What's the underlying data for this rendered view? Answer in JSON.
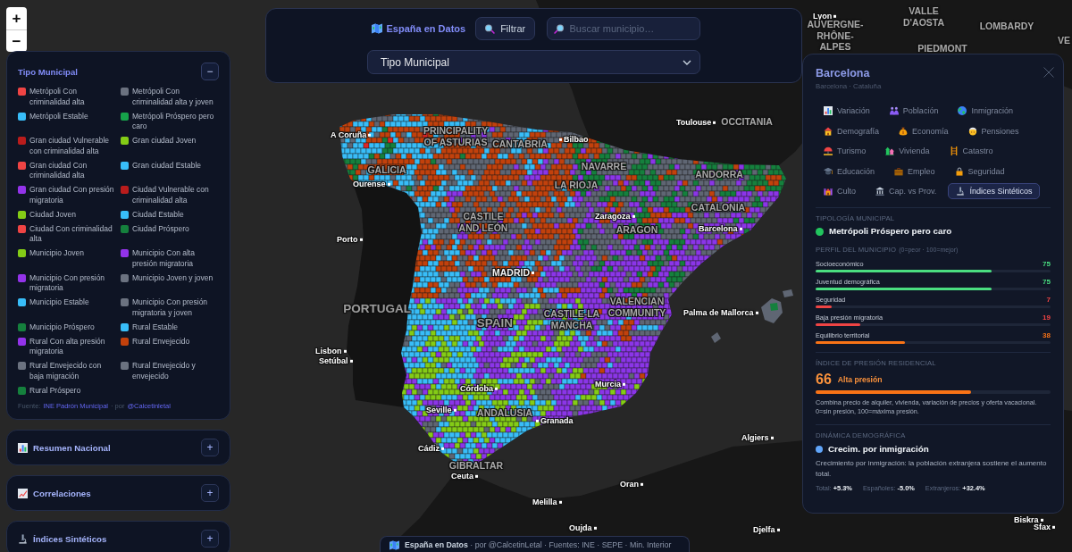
{
  "map_controls": {
    "zoom_in": "+",
    "zoom_out": "−"
  },
  "side_panels": [
    {
      "title": "Tipo Municipal",
      "toggle": "−",
      "expanded": true,
      "legend": [
        {
          "label": "Metrópoli Con criminalidad alta",
          "color": "#ef4444"
        },
        {
          "label": "Metrópoli Con criminalidad alta y joven",
          "color": "#6b7280"
        },
        {
          "label": "Metrópoli Estable",
          "color": "#38bdf8"
        },
        {
          "label": "Metrópoli Próspero pero caro",
          "color": "#16a34a"
        },
        {
          "label": "Gran ciudad Vulnerable con criminalidad alta",
          "color": "#b91c1c"
        },
        {
          "label": "Gran ciudad Joven",
          "color": "#84cc16"
        },
        {
          "label": "Gran ciudad Con criminalidad alta",
          "color": "#ef4444"
        },
        {
          "label": "Gran ciudad Estable",
          "color": "#38bdf8"
        },
        {
          "label": "Gran ciudad Con presión migratoria",
          "color": "#9333ea"
        },
        {
          "label": "Ciudad Vulnerable con criminalidad alta",
          "color": "#b91c1c"
        },
        {
          "label": "Ciudad Joven",
          "color": "#84cc16"
        },
        {
          "label": "Ciudad Estable",
          "color": "#38bdf8"
        },
        {
          "label": "Ciudad Con criminalidad alta",
          "color": "#ef4444"
        },
        {
          "label": "Ciudad Próspero",
          "color": "#15803d"
        },
        {
          "label": "Municipio Joven",
          "color": "#84cc16"
        },
        {
          "label": "Municipio Con alta presión migratoria",
          "color": "#9333ea"
        },
        {
          "label": "Municipio Con presión migratoria",
          "color": "#9333ea"
        },
        {
          "label": "Municipio Joven y joven",
          "color": "#6b7280"
        },
        {
          "label": "Municipio Estable",
          "color": "#38bdf8"
        },
        {
          "label": "Municipio Con presión migratoria y joven",
          "color": "#6b7280"
        },
        {
          "label": "Municipio Próspero",
          "color": "#15803d"
        },
        {
          "label": "Rural Estable",
          "color": "#38bdf8"
        },
        {
          "label": "Rural Con alta presión migratoria",
          "color": "#9333ea"
        },
        {
          "label": "Rural Envejecido",
          "color": "#c2410c"
        },
        {
          "label": "Rural Envejecido con baja migración",
          "color": "#6b7280"
        },
        {
          "label": "Rural Envejecido y envejecido",
          "color": "#6b7280"
        },
        {
          "label": "Rural Próspero",
          "color": "#15803d"
        }
      ],
      "source_note": [
        {
          "kind": "text",
          "text": "Fuente:"
        },
        {
          "kind": "link",
          "text": "INE Padrón Municipal"
        },
        {
          "kind": "text",
          "text": "· por"
        },
        {
          "kind": "link",
          "text": "@Calcetinletal"
        }
      ]
    },
    {
      "title": "Resumen Nacional",
      "toggle": "+",
      "expanded": false
    },
    {
      "title": "Correlaciones",
      "toggle": "+",
      "expanded": false
    },
    {
      "title": "Índices Sintéticos",
      "toggle": "+",
      "expanded": false
    }
  ],
  "header": {
    "title": "España en Datos",
    "filter_button": "Filtrar",
    "search": {
      "placeholder": "Buscar municipio…"
    },
    "layer_select": {
      "value": "Tipo Municipal"
    }
  },
  "map_labels": [
    {
      "text": "Lyon",
      "kind": "city"
    },
    {
      "text": "VALLE D'AOSTA",
      "kind": "region"
    },
    {
      "text": "AUVERGNE-RHÔNE-ALPES",
      "kind": "region"
    },
    {
      "text": "LOMBARDY",
      "kind": "region"
    },
    {
      "text": "PIEDMONT",
      "kind": "region"
    },
    {
      "text": "VE",
      "kind": "region"
    },
    {
      "text": "Toulouse",
      "kind": "city"
    },
    {
      "text": "OCCITANIA",
      "kind": "region"
    },
    {
      "text": "A Coruña",
      "kind": "city"
    },
    {
      "text": "PRINCIPALITY OF ASTURIAS",
      "kind": "region"
    },
    {
      "text": "CANTABRIA",
      "kind": "region"
    },
    {
      "text": "Bilbao",
      "kind": "city"
    },
    {
      "text": "GALICIA",
      "kind": "region"
    },
    {
      "text": "NAVARRE",
      "kind": "region"
    },
    {
      "text": "ANDORRA",
      "kind": "region"
    },
    {
      "text": "Ourense",
      "kind": "city"
    },
    {
      "text": "LA RIOJA",
      "kind": "region"
    },
    {
      "text": "CATALONIA",
      "kind": "region"
    },
    {
      "text": "CASTILE AND LEÓN",
      "kind": "region"
    },
    {
      "text": "Zaragoza",
      "kind": "city"
    },
    {
      "text": "ARAGON",
      "kind": "region"
    },
    {
      "text": "Barcelona",
      "kind": "city"
    },
    {
      "text": "Porto",
      "kind": "city"
    },
    {
      "text": "MADRID",
      "kind": "capital"
    },
    {
      "text": "PORTUGAL",
      "kind": "country"
    },
    {
      "text": "SPAIN",
      "kind": "country"
    },
    {
      "text": "CASTILE-LA MANCHA",
      "kind": "region"
    },
    {
      "text": "VALENCIAN COMMUNITY",
      "kind": "region"
    },
    {
      "text": "Palma de Mallorca",
      "kind": "city"
    },
    {
      "text": "Lisbon",
      "kind": "city"
    },
    {
      "text": "Setúbal",
      "kind": "city"
    },
    {
      "text": "Córdoba",
      "kind": "city"
    },
    {
      "text": "Murcia",
      "kind": "city"
    },
    {
      "text": "Seville",
      "kind": "city"
    },
    {
      "text": "ANDALUSIA",
      "kind": "region"
    },
    {
      "text": "Granada",
      "kind": "city"
    },
    {
      "text": "Algiers",
      "kind": "city"
    },
    {
      "text": "Cádiz",
      "kind": "city"
    },
    {
      "text": "GIBRALTAR",
      "kind": "region"
    },
    {
      "text": "Ceuta",
      "kind": "city"
    },
    {
      "text": "Oran",
      "kind": "city"
    },
    {
      "text": "Melilla",
      "kind": "city"
    },
    {
      "text": "Oujda",
      "kind": "city"
    },
    {
      "text": "Djelfa",
      "kind": "city"
    },
    {
      "text": "Biskra",
      "kind": "city"
    },
    {
      "text": "Sfax",
      "kind": "city"
    }
  ],
  "detail_panel": {
    "title": "Barcelona",
    "subtitle": "Barcelona · Cataluña",
    "tabs": [
      {
        "label": "Variación",
        "selected": false
      },
      {
        "label": "Población",
        "selected": false
      },
      {
        "label": "Inmigración",
        "selected": false
      },
      {
        "label": "Demografía",
        "selected": false
      },
      {
        "label": "Economía",
        "selected": false
      },
      {
        "label": "Pensiones",
        "selected": false
      },
      {
        "label": "Turismo",
        "selected": false
      },
      {
        "label": "Vivienda",
        "selected": false
      },
      {
        "label": "Catastro",
        "selected": false
      },
      {
        "label": "Educación",
        "selected": false
      },
      {
        "label": "Empleo",
        "selected": false
      },
      {
        "label": "Seguridad",
        "selected": false
      },
      {
        "label": "Culto",
        "selected": false
      },
      {
        "label": "Cap. vs Prov.",
        "selected": false
      },
      {
        "label": "Índices Sintéticos",
        "selected": true
      }
    ],
    "typology": {
      "heading": "TIPOLOGÍA MUNICIPAL",
      "value": "Metrópoli Próspero pero caro"
    },
    "profile": {
      "heading": "PERFIL DEL MUNICIPIO",
      "hint": "(0=peor · 100=mejor)",
      "metrics": [
        {
          "label": "Socioeconómico",
          "reading": "75",
          "level": 0.75,
          "color": "#4ade80"
        },
        {
          "label": "Juventud demográfica",
          "reading": "75",
          "level": 0.75,
          "color": "#4ade80"
        },
        {
          "label": "Seguridad",
          "reading": "7",
          "level": 0.07,
          "color": "#ef4444"
        },
        {
          "label": "Baja presión migratoria",
          "reading": "19",
          "level": 0.19,
          "color": "#ef4444"
        },
        {
          "label": "Equilibrio territorial",
          "reading": "38",
          "level": 0.38,
          "color": "#f97316"
        }
      ]
    },
    "pressure": {
      "heading": "ÍNDICE DE PRESIÓN RESIDENCIAL",
      "score": "66",
      "rating": "Alta presión",
      "level": 0.66,
      "description": "Combina precio de alquiler, vivienda, variación de precios y oferta vacacional.\n0=sin presión, 100=máxima presión."
    },
    "dynamics": {
      "heading": "DINÁMICA DEMOGRÁFICA",
      "value": "Crecim. por inmigración",
      "description": "Crecimiento por inmigración: la población extranjera sostiene el aumento total.",
      "stats": [
        "Total: **+5.3%**",
        "Españoles: **-5.0%**",
        "Extranjeros: **+32.4%**"
      ]
    }
  },
  "attribution": "**España en Datos** · por @CalcetinLetal · Fuentes: INE · SEPE · Min. Interior"
}
